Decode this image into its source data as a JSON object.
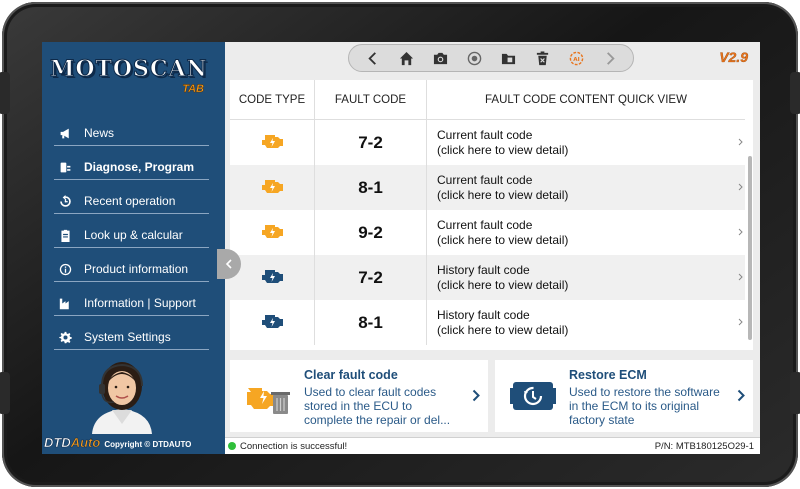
{
  "app": {
    "logo_main": "MOTOSCAN",
    "logo_sub": "TAB",
    "version": "V2.9"
  },
  "sidebar": {
    "items": [
      {
        "label": "News",
        "icon": "megaphone-icon"
      },
      {
        "label": "Diagnose, Program",
        "icon": "diagnose-icon",
        "active": true
      },
      {
        "label": "Recent operation",
        "icon": "history-icon"
      },
      {
        "label": "Look up & calcular",
        "icon": "clipboard-icon"
      },
      {
        "label": "Product information",
        "icon": "info-icon"
      },
      {
        "label": "Information | Support",
        "icon": "factory-icon"
      },
      {
        "label": "System Settings",
        "icon": "gear-icon"
      }
    ],
    "brand_dtd": "DTD",
    "brand_auto": "Auto",
    "copyright": "Copyright © DTDAUTO"
  },
  "toolbar": {
    "buttons": [
      "back-icon",
      "home-icon",
      "camera-icon",
      "record-icon",
      "folder-icon",
      "delete-icon",
      "auto-icon",
      "forward-icon"
    ]
  },
  "table": {
    "headers": {
      "type": "CODE TYPE",
      "code": "FAULT CODE",
      "content": "FAULT CODE CONTENT QUICK VIEW"
    },
    "rows": [
      {
        "kind": "current",
        "code": "7-2",
        "line1": "Current fault code",
        "line2": "(click here to view detail)"
      },
      {
        "kind": "current",
        "code": "8-1",
        "line1": "Current fault code",
        "line2": "(click here to view detail)"
      },
      {
        "kind": "current",
        "code": "9-2",
        "line1": "Current fault code",
        "line2": "(click here to view detail)"
      },
      {
        "kind": "history",
        "code": "7-2",
        "line1": "History fault code",
        "line2": "(click here to view detail)"
      },
      {
        "kind": "history",
        "code": "8-1",
        "line1": "History fault code",
        "line2": "(click here to view detail)"
      }
    ]
  },
  "cards": {
    "clear": {
      "title": "Clear fault code",
      "desc": "Used to clear fault codes stored in the ECU to complete the repair or del..."
    },
    "restore": {
      "title": "Restore ECM",
      "desc": "Used to restore the software in the ECM to its original factory state"
    }
  },
  "status": {
    "connection": "Connection is successful!",
    "part_number": "P/N: MTB180125O29-1"
  },
  "colors": {
    "sidebar": "#1f4e79",
    "current_icon": "#f6a623",
    "history_icon": "#1f4e79",
    "accent": "#e8741c",
    "ok": "#2fbf3a"
  }
}
